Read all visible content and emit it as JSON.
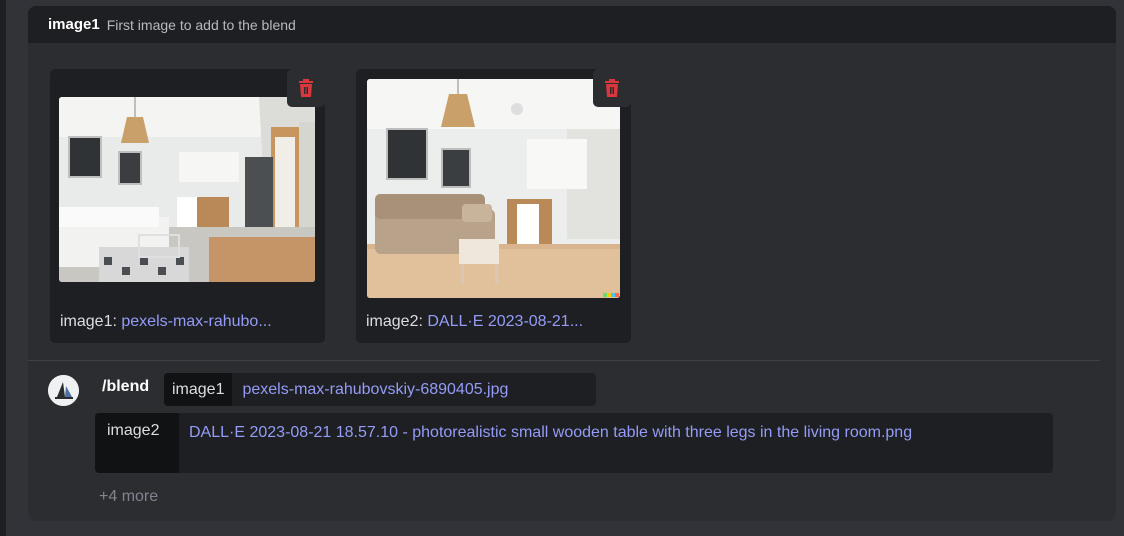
{
  "option": {
    "name": "image1",
    "description": "First image to add to the blend"
  },
  "attachments": [
    {
      "label": "image1:",
      "filename": "pexels-max-rahubo...",
      "delete_icon": "trash-icon",
      "image_desc": "white living room with sofa"
    },
    {
      "label": "image2:",
      "filename": "DALL·E 2023-08-21...",
      "delete_icon": "trash-icon",
      "image_desc": "living room with beige sofa and small wooden table"
    }
  ],
  "command": {
    "name": "/blend",
    "args": [
      {
        "key": "image1",
        "value": "pexels-max-rahubovskiy-6890405.jpg"
      },
      {
        "key": "image2",
        "value": "DALL·E 2023-08-21 18.57.10 - photorealistic small wooden table with three legs in the living room.png"
      }
    ],
    "more": "+4 more"
  },
  "colors": {
    "background": "#313338",
    "panel": "#2b2d31",
    "header": "#1e1f22",
    "link": "#949cf7",
    "danger": "#da373c"
  }
}
